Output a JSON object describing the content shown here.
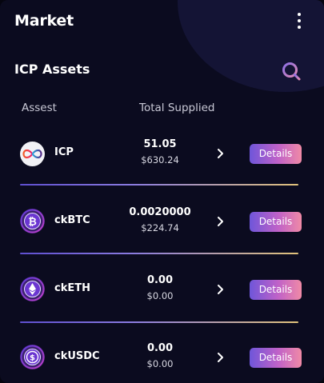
{
  "header": {
    "title": "Market"
  },
  "section": {
    "title": "ICP Assets"
  },
  "columns": {
    "asset": "Assest",
    "supplied": "Total Supplied"
  },
  "assets": [
    {
      "name": "ICP",
      "amount": "51.05",
      "usd": "$630.24",
      "details_label": "Details",
      "icon": "icp-icon"
    },
    {
      "name": "ckBTC",
      "amount": "0.0020000",
      "usd": "$224.74",
      "details_label": "Details",
      "icon": "bitcoin-icon"
    },
    {
      "name": "ckETH",
      "amount": "0.00",
      "usd": "$0.00",
      "details_label": "Details",
      "icon": "ethereum-icon"
    },
    {
      "name": "ckUSDC",
      "amount": "0.00",
      "usd": "$0.00",
      "details_label": "Details",
      "icon": "usdc-icon"
    }
  ],
  "colors": {
    "background": "#0b0b1f",
    "accent_start": "#6f56d9",
    "accent_end": "#f08aa6",
    "divider_end": "#e1c27a"
  }
}
